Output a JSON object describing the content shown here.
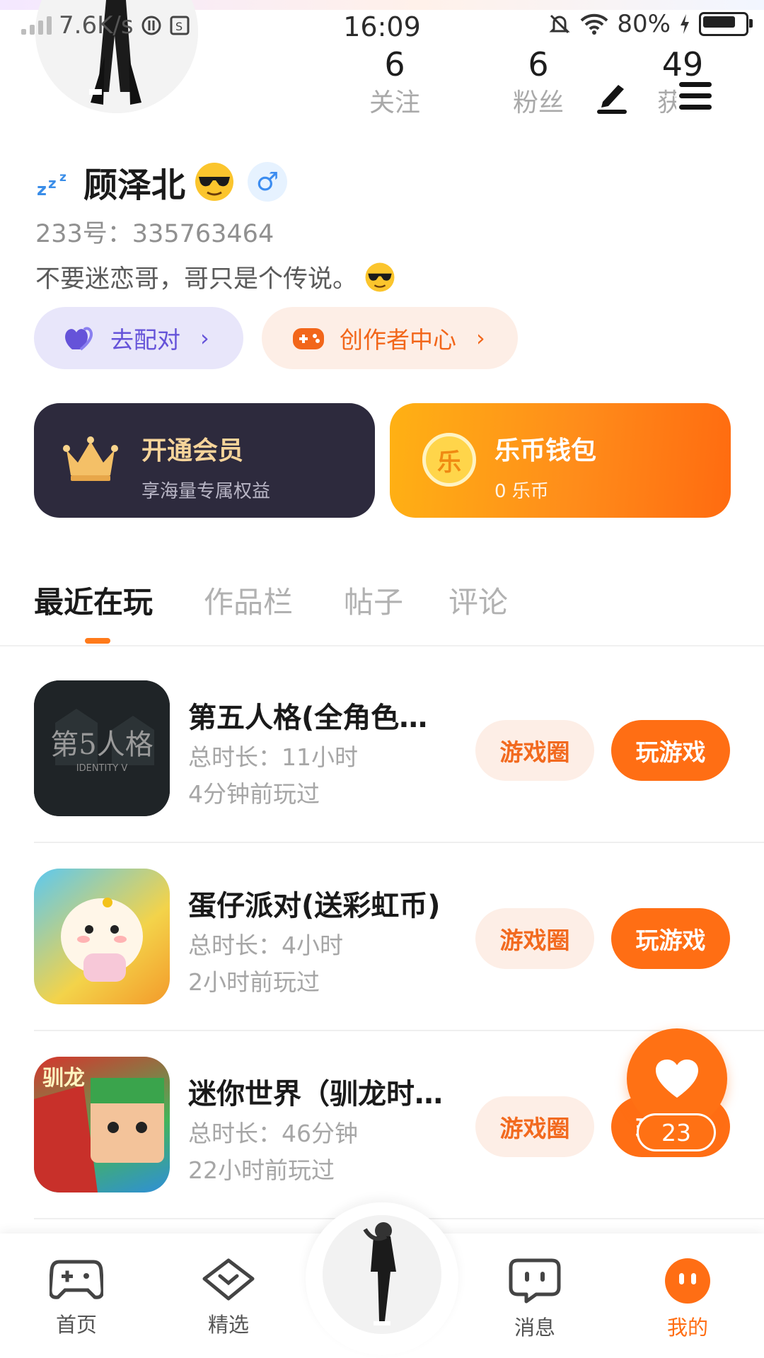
{
  "status_bar": {
    "net_speed": "7.6K/s",
    "time": "16:09",
    "battery": "80%"
  },
  "stats": {
    "following": {
      "count": "6",
      "label": "关注"
    },
    "fans": {
      "count": "6",
      "label": "粉丝"
    },
    "likes": {
      "count": "49",
      "label": "获赞"
    }
  },
  "profile": {
    "name": "顾泽北",
    "gender_symbol": "♂",
    "uid": "233号：335763464",
    "bio": "不要迷恋哥，哥只是个传说。"
  },
  "actions": {
    "match_label": "去配对",
    "creator_label": "创作者中心"
  },
  "cards": {
    "vip": {
      "title": "开通会员",
      "subtitle": "享海量专属权益"
    },
    "wallet": {
      "title": "乐币钱包",
      "subtitle": "0 乐币",
      "coin_char": "乐"
    }
  },
  "tabs": [
    "最近在玩",
    "作品栏",
    "帖子",
    "评论"
  ],
  "games": [
    {
      "title": "第五人格(全角色…",
      "duration": "总时长：11小时",
      "last_played": "4分钟前玩过",
      "circle_label": "游戏圈",
      "play_label": "玩游戏",
      "icon_text": "第5人格",
      "icon_sub": "IDENTITY V"
    },
    {
      "title": "蛋仔派对(送彩虹币)",
      "duration": "总时长：4小时",
      "last_played": "2小时前玩过",
      "circle_label": "游戏圈",
      "play_label": "玩游戏"
    },
    {
      "title": "迷你世界（驯龙时…",
      "duration": "总时长：46分钟",
      "last_played": "22小时前玩过",
      "circle_label": "游戏圈",
      "play_label": "玩游戏",
      "icon_text": "驯龙"
    }
  ],
  "floating": {
    "like_count": "23"
  },
  "nav": [
    {
      "label": "首页",
      "icon": "gamepad-icon"
    },
    {
      "label": "精选",
      "icon": "heart-bubble-icon"
    },
    {
      "label": "",
      "icon": "avatar"
    },
    {
      "label": "消息",
      "icon": "chat-icon"
    },
    {
      "label": "我的",
      "icon": "profile-face-icon"
    }
  ],
  "colors": {
    "accent": "#ff6e14",
    "match": "#6553d9",
    "vip_bg": "#2d2a3d"
  }
}
